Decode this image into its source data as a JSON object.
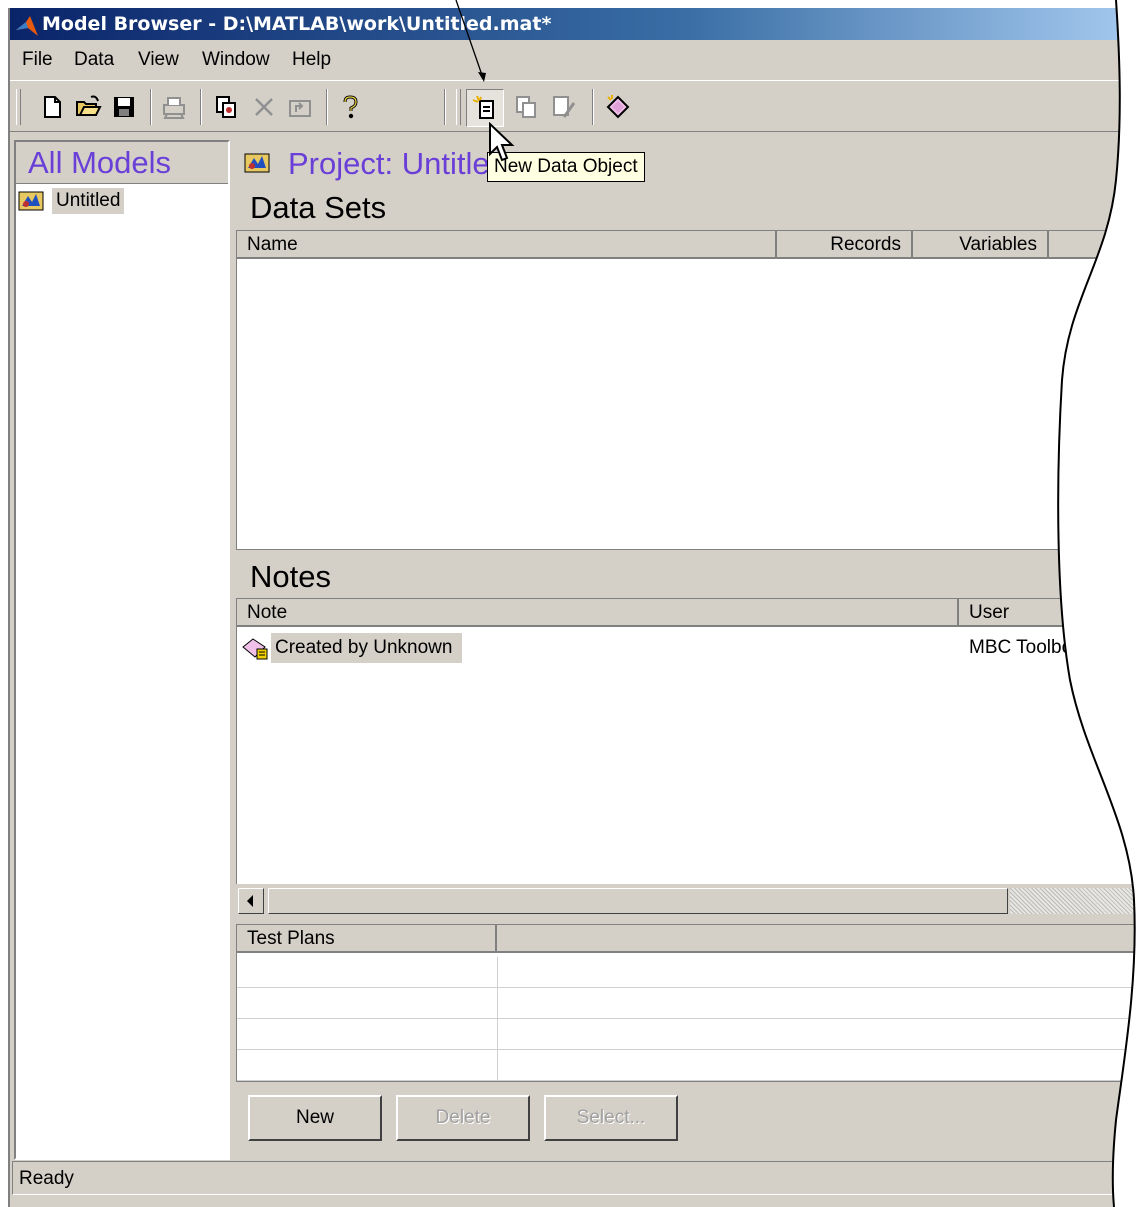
{
  "window": {
    "title": "Model Browser - D:\\MATLAB\\work\\Untitled.mat*"
  },
  "menu": {
    "items": [
      "File",
      "Data",
      "View",
      "Window",
      "Help"
    ]
  },
  "toolbar": {
    "buttons": [
      "new-file",
      "open-folder",
      "save",
      "print",
      "copy-model",
      "delete",
      "up-level",
      "help",
      "new-data-object",
      "copy-data-object",
      "edit-data",
      "new-test-plan"
    ]
  },
  "tooltip": {
    "text": "New Data Object"
  },
  "left_panel": {
    "title": "All Models",
    "tree": [
      {
        "label": "Untitled"
      }
    ]
  },
  "project": {
    "title": "Project: Untitled"
  },
  "data_sets": {
    "title": "Data Sets",
    "columns": [
      "Name",
      "Records",
      "Variables"
    ],
    "rows": []
  },
  "notes": {
    "title": "Notes",
    "columns": [
      "Note",
      "User"
    ],
    "rows": [
      {
        "note": "Created by Unknown",
        "user": "MBC Toolbo"
      }
    ]
  },
  "test_plans": {
    "columns": [
      "Test Plans",
      ""
    ],
    "rows": 4
  },
  "buttons": {
    "new": "New",
    "delete": "Delete",
    "select": "Select..."
  },
  "status": {
    "text": "Ready"
  }
}
